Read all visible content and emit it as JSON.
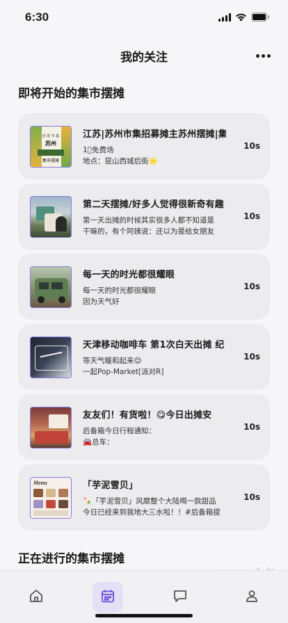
{
  "status_bar": {
    "time": "6:30"
  },
  "header": {
    "title": "我的关注"
  },
  "upcoming": {
    "title": "即将开始的集市摆摊",
    "items": [
      {
        "title": "江苏|苏州市集招募摊主苏州摆摊|集",
        "line1": "1⃣️免费场",
        "line2": "地点：昆山西城后街🌟",
        "time": "10s",
        "thumb": {
          "line1": "创 意 市 集",
          "line2": "苏州",
          "line3": "集市摆摊"
        }
      },
      {
        "title": "第二天摆摊/好多人觉得很新奇有趣",
        "line1": "第一天出摊的时候其实很多人都不知道是",
        "line2": "干嘛的，有个阿姨说：还以为是给女朋友",
        "time": "10s"
      },
      {
        "title": "每一天的时光都很耀眼",
        "line1": "每一天的时光都很耀眼",
        "line2": "因为天气好",
        "time": "10s"
      },
      {
        "title": "天津移动咖啡车 第1次白天出摊 纪",
        "line1": "等天气暖和起来😊",
        "line2": "一起Pop-Market[派对R]",
        "time": "10s"
      },
      {
        "title": "友友们！有货啦！😋今日出摊安",
        "line1": "后备箱今日行程通知：",
        "line2": "🚘总车：",
        "time": "10s"
      },
      {
        "title": "「芋泥雪贝」",
        "line1": "🍡「芋泥雪贝」风靡整个大陆喝一款甜品",
        "line2": "今日已经来到我地大三水啦！！#后备箱提",
        "time": "10s",
        "thumb": {
          "line1": "Menu"
        }
      }
    ]
  },
  "ongoing": {
    "title": "正在进行的集市摆摊"
  },
  "tabbar": {
    "items": [
      {
        "icon": "home-icon"
      },
      {
        "icon": "calendar-icon"
      },
      {
        "icon": "chat-icon"
      },
      {
        "icon": "user-icon"
      }
    ]
  },
  "watermark": {
    "text": "168下载"
  }
}
